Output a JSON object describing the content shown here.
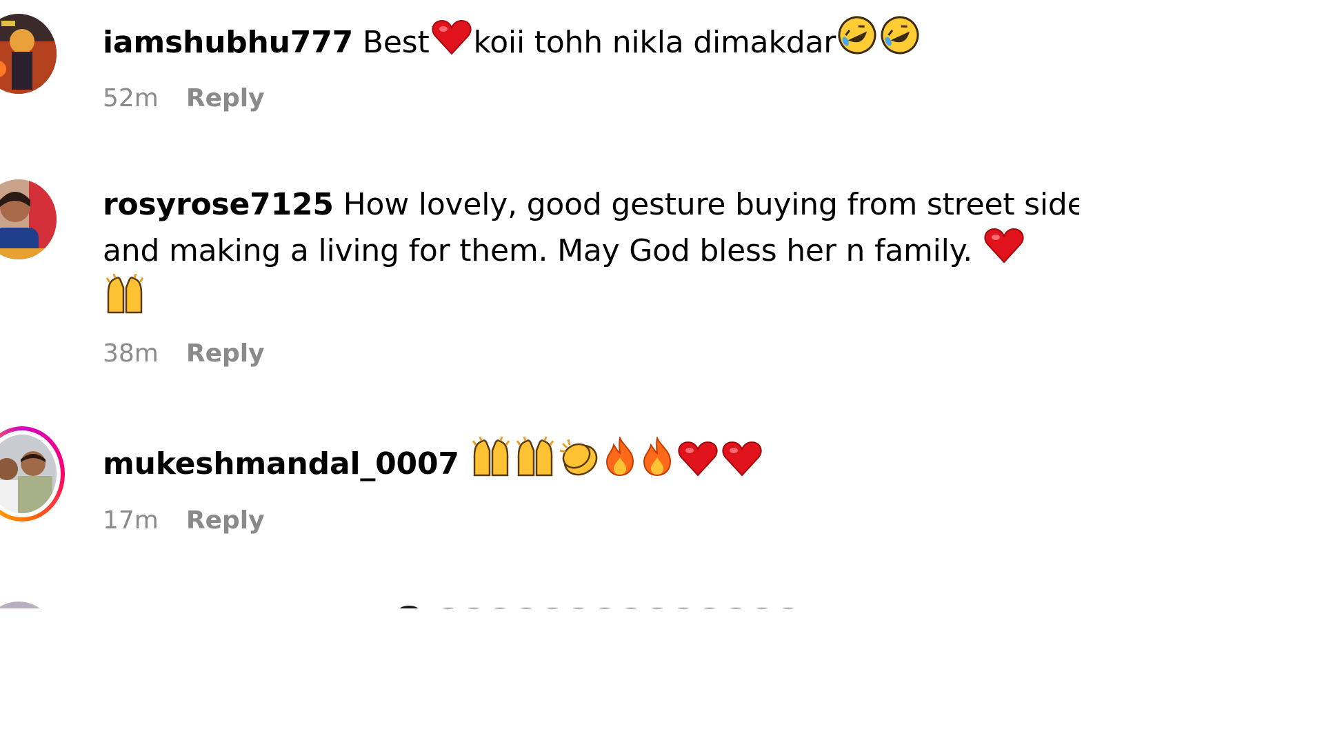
{
  "comments": [
    {
      "username": "iamshubhu777",
      "text_parts": [
        "Best",
        "koii tohh nikla dimakdar"
      ],
      "time": "52m",
      "reply_label": "Reply"
    },
    {
      "username": "rosyrose7125",
      "line1": "How lovely, good gesture buying from street side",
      "line2": "and making a living for them. May God bless her n family.",
      "time": "38m",
      "reply_label": "Reply"
    },
    {
      "username": "mukeshmandal_0007",
      "time": "17m",
      "reply_label": "Reply"
    }
  ],
  "icons": {
    "heart": "red-heart-icon",
    "rofl": "rofl-emoji-icon",
    "raised_hands": "raising-hands-icon",
    "clap": "clapping-hands-icon",
    "fire": "fire-icon"
  },
  "colors": {
    "meta_text": "#8a8a8a",
    "story_ring_start": "#d300c5",
    "story_ring_end": "#ff7a00"
  }
}
